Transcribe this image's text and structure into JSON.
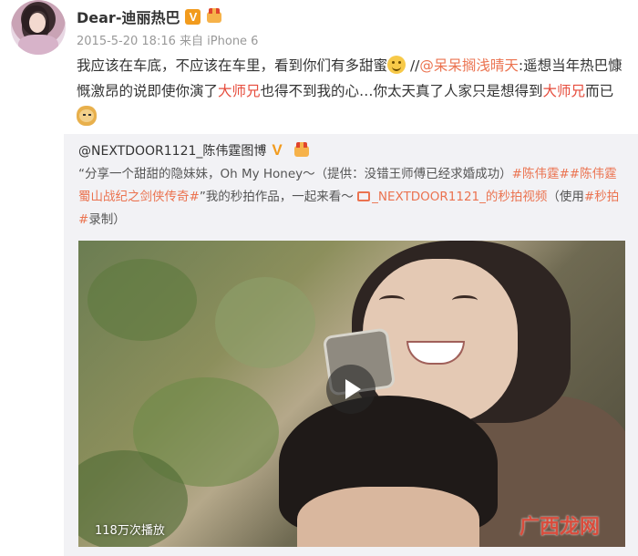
{
  "post": {
    "username": "Dear-迪丽热巴",
    "verified_badge": "V",
    "timestamp": "2015-5-20 18:16",
    "source_prefix": "来自",
    "source": "iPhone 6",
    "text_part1": "我应该在车底，不应该在车里，看到你们有多甜蜜",
    "text_sep": " //",
    "mention": "@呆呆搁浅晴天",
    "text_part2": ":遥想当年热巴慷慨激昂的说即使你演了",
    "highlight1": "大师兄",
    "text_part3": "也得不到我的心…你太天真了人家只是想得到",
    "highlight2": "大师兄",
    "text_part4": "而已"
  },
  "repost": {
    "author": "@NEXTDOOR1121_陈伟霆图博",
    "text_part1": "“分享一个甜甜的隐妹妹，Oh My Honey～（提供：没错王师傅已经求婚成功）",
    "hashtag1": "#陈伟霆#",
    "hashtag2": "#陈伟霆蜀山战纪之剑侠传奇#",
    "text_part2": "”我的秒拍作品，一起来看～",
    "link_text": "_NEXTDOOR1121_的秒拍视频",
    "text_part3": "（使用",
    "hashtag3": "#秒拍#",
    "text_part4": "录制）"
  },
  "video": {
    "views": "118万次播放"
  },
  "watermark": {
    "text": "广西龙网"
  },
  "colors": {
    "highlight_red": "#e64c3c",
    "link_orange": "#eb7350",
    "badge_orange": "#f29b1d"
  }
}
